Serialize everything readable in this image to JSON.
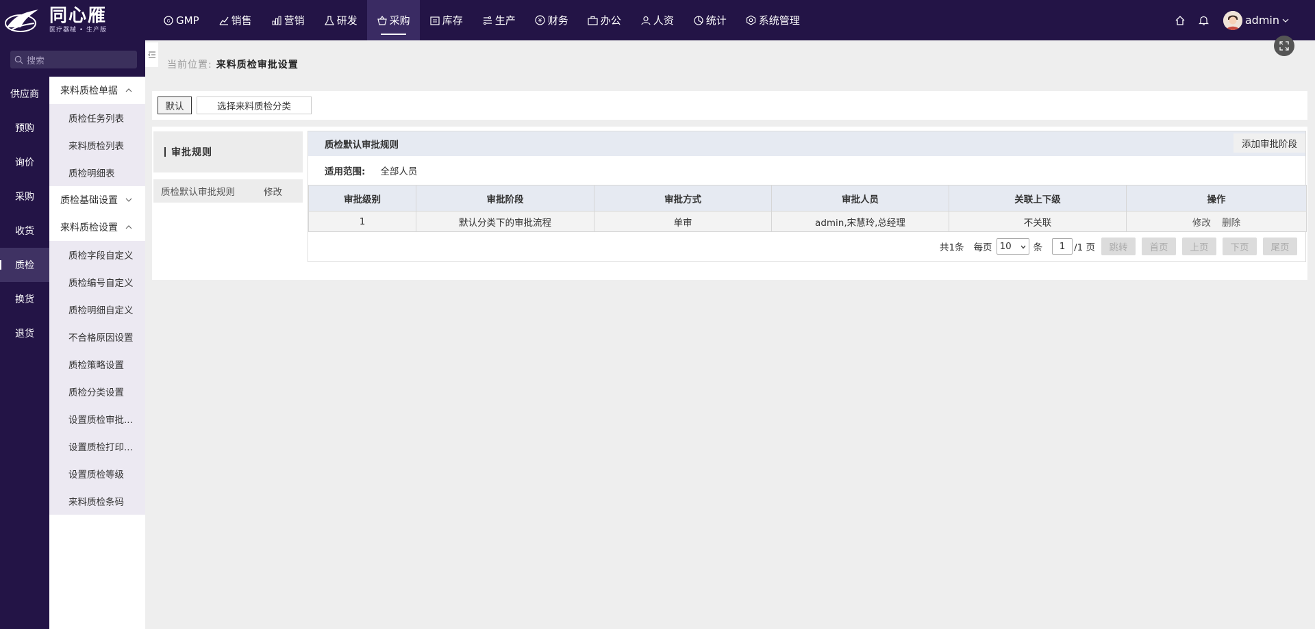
{
  "app": {
    "title": "同心雁",
    "subtitle": "医疗器械 • 生产版"
  },
  "nav": [
    {
      "label": "GMP",
      "icon": "gmp-icon"
    },
    {
      "label": "销售",
      "icon": "chart-icon"
    },
    {
      "label": "营销",
      "icon": "bar-chart-icon"
    },
    {
      "label": "研发",
      "icon": "flask-icon"
    },
    {
      "label": "采购",
      "icon": "basket-icon",
      "active": true
    },
    {
      "label": "库存",
      "icon": "warehouse-icon"
    },
    {
      "label": "生产",
      "icon": "production-icon"
    },
    {
      "label": "财务",
      "icon": "yen-icon"
    },
    {
      "label": "办公",
      "icon": "briefcase-icon"
    },
    {
      "label": "人资",
      "icon": "person-icon"
    },
    {
      "label": "统计",
      "icon": "pie-icon"
    },
    {
      "label": "系统管理",
      "icon": "hexagon-gear-icon"
    }
  ],
  "user": {
    "name": "admin"
  },
  "search": {
    "placeholder": "搜索"
  },
  "side1": [
    "供应商",
    "预购",
    "询价",
    "采购",
    "收货",
    "质检",
    "换货",
    "退货"
  ],
  "side1_active": "质检",
  "side2": {
    "group1": "来料质检单据",
    "group1_items": [
      "质检任务列表",
      "来料质检列表",
      "质检明细表"
    ],
    "group2": "质检基础设置",
    "group3": "来料质检设置",
    "group3_items": [
      "质检字段自定义",
      "质检编号自定义",
      "质检明细自定义",
      "不合格原因设置",
      "质检策略设置",
      "质检分类设置",
      "设置质检审批...",
      "设置质检打印...",
      "设置质检等级",
      "来料质检条码"
    ]
  },
  "breadcrumb": {
    "label": "当前位置:",
    "current": "来料质检审批设置"
  },
  "tabs": {
    "default": "默认",
    "choose": "选择来料质检分类"
  },
  "rules": {
    "header": "审批规则",
    "item": "质检默认审批规则",
    "edit": "修改"
  },
  "panel": {
    "title": "质检默认审批规则",
    "add_button": "添加审批阶段",
    "scope_label": "适用范围:",
    "scope_value": "全部人员"
  },
  "table": {
    "columns": [
      "审批级别",
      "审批阶段",
      "审批方式",
      "审批人员",
      "关联上下级",
      "操作"
    ],
    "rows": [
      {
        "level": "1",
        "stage": "默认分类下的审批流程",
        "method": "单审",
        "approvers": "admin,宋慧玲,总经理",
        "link": "不关联",
        "op_edit": "修改",
        "op_delete": "删除"
      }
    ]
  },
  "pager": {
    "total": "共1条",
    "per_page_label": "每页",
    "per_page": "10",
    "unit": "条",
    "page": "1",
    "pages": "/1 页",
    "jump": "跳转",
    "first": "首页",
    "prev": "上页",
    "next": "下页",
    "last": "尾页"
  }
}
